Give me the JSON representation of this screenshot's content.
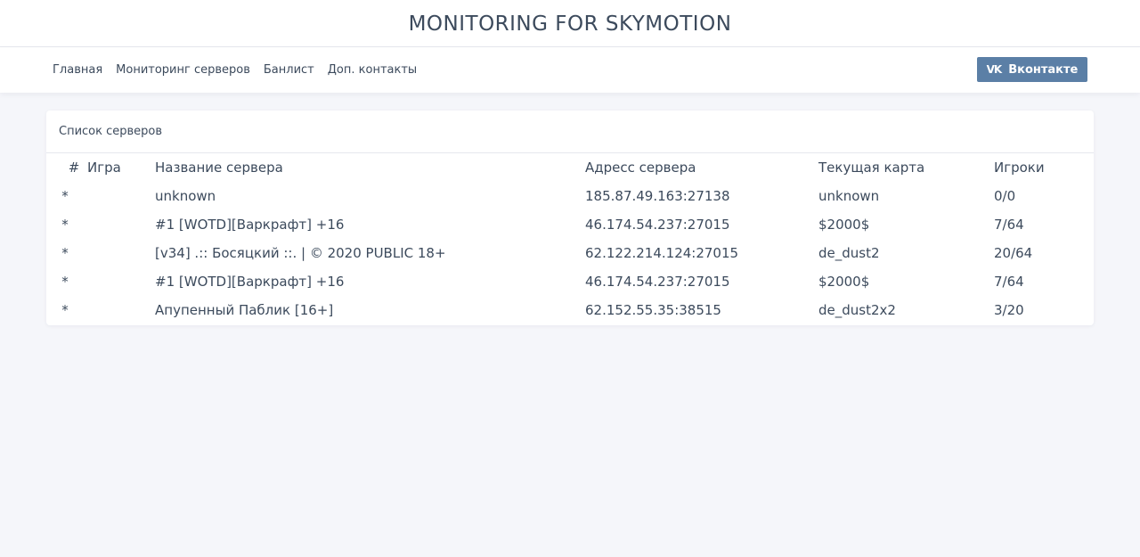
{
  "header": {
    "title": "MONITORING FOR SKYMOTION"
  },
  "nav": {
    "links": [
      "Главная",
      "Мониторинг серверов",
      "Банлист",
      "Доп. контакты"
    ],
    "vk_button": "Вконтакте",
    "vk_icon": "vk"
  },
  "servers": {
    "title": "Список серверов",
    "columns": [
      "#",
      "Игра",
      "Название сервера",
      "Адресс сервера",
      "Текущая карта",
      "Игроки"
    ],
    "rows": [
      {
        "num": "*",
        "game": "",
        "name": "unknown",
        "address": "185.87.49.163:27138",
        "map": "unknown",
        "players": "0/0"
      },
      {
        "num": "*",
        "game": "",
        "name": "#1 [WOTD][Варкрафт] +16",
        "address": "46.174.54.237:27015",
        "map": "$2000$",
        "players": "7/64"
      },
      {
        "num": "*",
        "game": "",
        "name": "[v34] .:: Босяцкий ::. | © 2020 PUBLIC 18+",
        "address": "62.122.214.124:27015",
        "map": "de_dust2",
        "players": "20/64"
      },
      {
        "num": "*",
        "game": "",
        "name": "#1 [WOTD][Варкрафт] +16",
        "address": "46.174.54.237:27015",
        "map": "$2000$",
        "players": "7/64"
      },
      {
        "num": "*",
        "game": "",
        "name": "Апупенный Паблик [16+]",
        "address": "62.152.55.35:38515",
        "map": "de_dust2x2",
        "players": "3/20"
      }
    ]
  }
}
